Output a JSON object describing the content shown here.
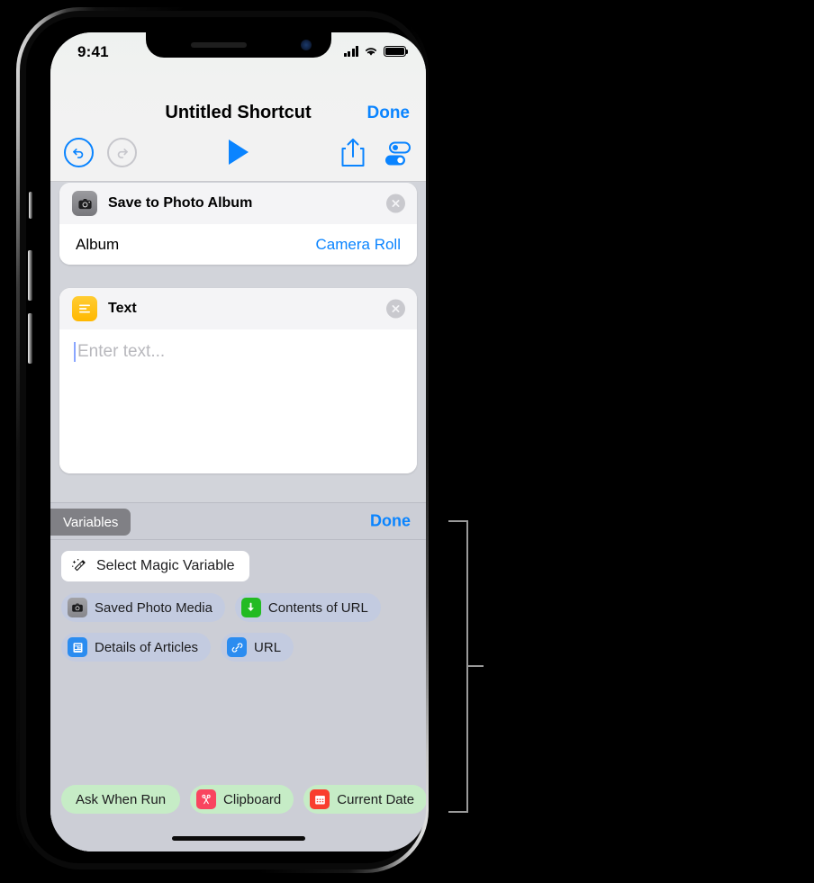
{
  "status_bar": {
    "time": "9:41",
    "signal_icon": "cellular-bars-icon",
    "wifi_icon": "wifi-icon",
    "battery_icon": "battery-full-icon"
  },
  "nav": {
    "title": "Untitled Shortcut",
    "done_label": "Done"
  },
  "toolbar": {
    "undo_icon": "undo-arrow-icon",
    "redo_icon": "redo-arrow-icon",
    "play_icon": "play-triangle-icon",
    "share_icon": "share-up-arrow-icon",
    "settings_icon": "toggle-sliders-icon"
  },
  "actions": [
    {
      "icon": "camera-icon",
      "title": "Save to Photo Album",
      "remove_icon": "close-circle-icon",
      "rows": [
        {
          "label": "Album",
          "value": "Camera Roll"
        }
      ]
    },
    {
      "icon": "text-lines-icon",
      "title": "Text",
      "remove_icon": "close-circle-icon",
      "placeholder": "Enter text..."
    }
  ],
  "variables_bar": {
    "tab_label": "Variables",
    "done_label": "Done"
  },
  "variable_picker": {
    "magic_button": {
      "label": "Select Magic Variable",
      "icon": "magic-wand-icon"
    },
    "magic_variables": [
      {
        "label": "Saved Photo Media",
        "icon": "camera-icon",
        "icon_color": "#86868b"
      },
      {
        "label": "Contents of URL",
        "icon": "download-arrow-icon",
        "icon_color": "#22bb22"
      },
      {
        "label": "Details of Articles",
        "icon": "article-icon",
        "icon_color": "#2b8cf0"
      },
      {
        "label": "URL",
        "icon": "link-icon",
        "icon_color": "#2b8cf0"
      }
    ],
    "special_variables": [
      {
        "label": "Ask When Run",
        "icon": "none"
      },
      {
        "label": "Clipboard",
        "icon": "scissors-icon",
        "icon_color": "#f9455f"
      },
      {
        "label": "Current Date",
        "icon": "calendar-icon",
        "icon_color": "#f93e2e"
      }
    ]
  },
  "colors": {
    "accent_blue": "#0a84ff",
    "panel_gray": "#ccced6",
    "chip_blue": "#c3cbe0",
    "chip_green": "#c6ecc6",
    "tab_gray": "#808085"
  }
}
